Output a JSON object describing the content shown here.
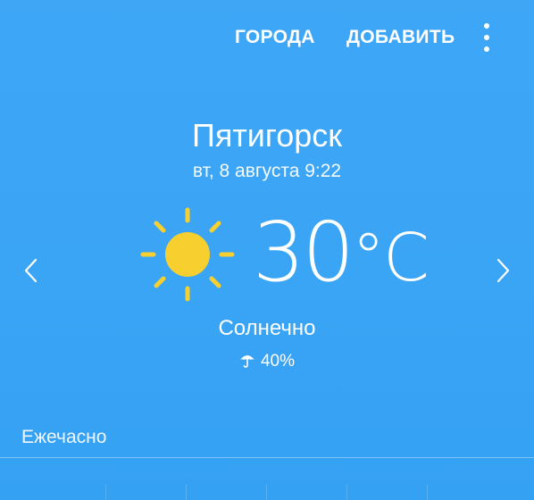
{
  "toolbar": {
    "cities_label": "ГОРОДА",
    "add_label": "ДОБАВИТЬ",
    "menu_icon": "more-vert-icon"
  },
  "weather": {
    "city": "Пятигорск",
    "datetime": "вт, 8 августа 9:22",
    "temperature": "30",
    "unit": "°C",
    "condition": "Солнечно",
    "precipitation": "40%",
    "condition_icon": "sun-icon",
    "precipitation_icon": "umbrella-icon"
  },
  "hourly": {
    "title": "Ежечасно"
  },
  "colors": {
    "background": "#3ea5f5",
    "sun": "#f7cf2f",
    "text": "#ffffff"
  }
}
